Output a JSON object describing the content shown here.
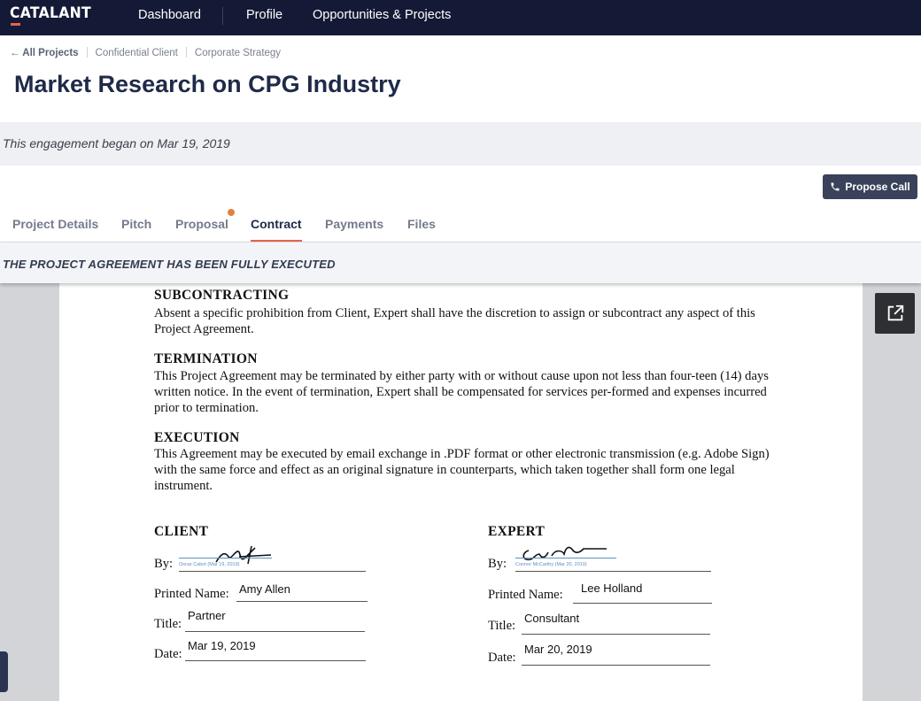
{
  "brand": {
    "logo": "CATALANT"
  },
  "nav": {
    "items": [
      "Dashboard",
      "Profile",
      "Opportunities & Projects"
    ]
  },
  "breadcrumb": {
    "back": "← All Projects",
    "client": "Confidential Client",
    "category": "Corporate Strategy"
  },
  "page": {
    "title": "Market Research on CPG Industry"
  },
  "banner": {
    "text": "This engagement began on Mar 19, 2019"
  },
  "actions": {
    "propose_call": "Propose Call"
  },
  "tabs": [
    {
      "label": "Project Details"
    },
    {
      "label": "Pitch"
    },
    {
      "label": "Proposal"
    },
    {
      "label": "Contract"
    },
    {
      "label": "Payments"
    },
    {
      "label": "Files"
    }
  ],
  "status": {
    "executed": "THE PROJECT AGREEMENT HAS BEEN FULLY EXECUTED"
  },
  "document": {
    "sections": [
      {
        "heading": "SUBCONTRACTING",
        "body": "Absent a specific prohibition from Client, Expert shall have the discretion to assign or subcontract any aspect of this Project Agreement."
      },
      {
        "heading": "TERMINATION",
        "body": "This Project Agreement may be terminated by either party with or without cause upon not less than four-teen (14) days written notice. In the event of termination, Expert shall be compensated for services per-formed and expenses incurred prior to termination."
      },
      {
        "heading": "EXECUTION",
        "body": "This Agreement may be executed by email exchange in .PDF format or other electronic transmission (e.g. Adobe Sign) with the same force and effect as an original signature in counterparts, which taken together shall form one legal instrument."
      }
    ],
    "labels": {
      "by": "By:",
      "printed_name": "Printed Name:",
      "title": "Title:",
      "date": "Date:"
    },
    "client": {
      "heading": "CLIENT",
      "signature_caption": "Oscar Cabot (Mar 19, 2019)",
      "printed_name": "Amy Allen",
      "title": "Partner",
      "date": "Mar 19, 2019"
    },
    "expert": {
      "heading": "EXPERT",
      "signature_caption": "Connor McCarthy (Mar 20, 2019)",
      "printed_name": "Lee Holland",
      "title": "Consultant",
      "date": "Mar 20, 2019"
    }
  },
  "icons": {
    "phone": "phone-icon",
    "external": "external-link-icon"
  },
  "colors": {
    "nav_bg": "#141a35",
    "accent": "#e4654a",
    "button_bg": "#39425a"
  }
}
